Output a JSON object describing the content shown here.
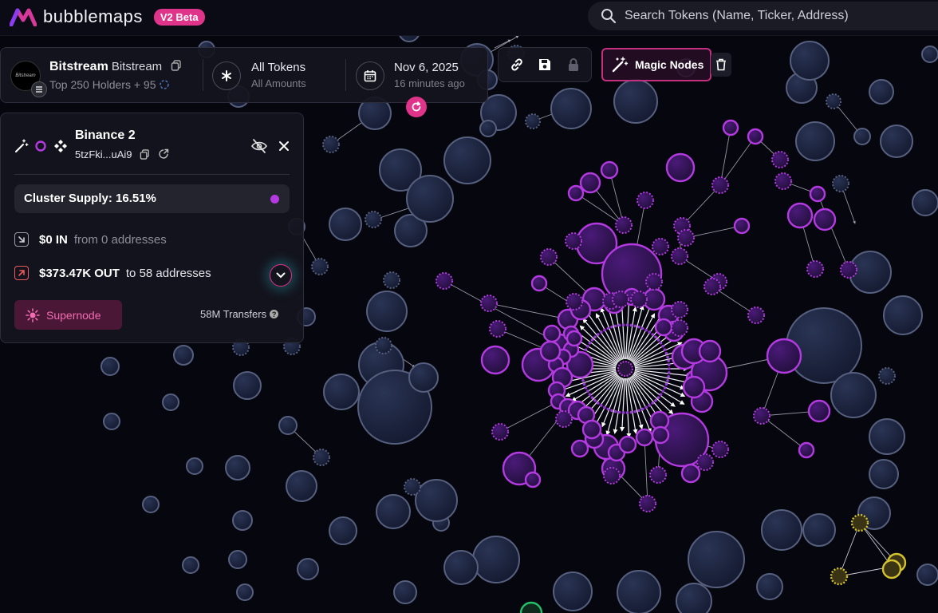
{
  "app": {
    "name": "bubblemaps",
    "badge": "V2 Beta"
  },
  "search": {
    "placeholder": "Search Tokens (Name, Ticker, Address)"
  },
  "token": {
    "name": "Bitstream",
    "symbol": "Bitstream",
    "holders_label": "Top 250 Holders + 95",
    "avatar_text": "Bitstream"
  },
  "filter": {
    "title": "All Tokens",
    "subtitle": "All Amounts"
  },
  "date": {
    "title": "Nov 6, 2025",
    "subtitle": "16 minutes ago"
  },
  "toolbar": {
    "magic_nodes_label": "Magic Nodes"
  },
  "details": {
    "title": "Binance 2",
    "address": "5tzFki...uAi9",
    "cluster_label": "Cluster Supply: 16.51%",
    "in_amount": "$0 IN",
    "in_text": "from 0 addresses",
    "out_amount": "$373.47K OUT",
    "out_text": "to 58 addresses",
    "supernode_label": "Supernode",
    "transfers_label": "58M Transfers"
  },
  "colors": {
    "accent": "#e0338a",
    "cluster": "#b33ae0",
    "bubble": "#1c2440",
    "bubble_stroke": "#56607e",
    "yellow": "#d4c22e",
    "green": "#25c06a"
  }
}
